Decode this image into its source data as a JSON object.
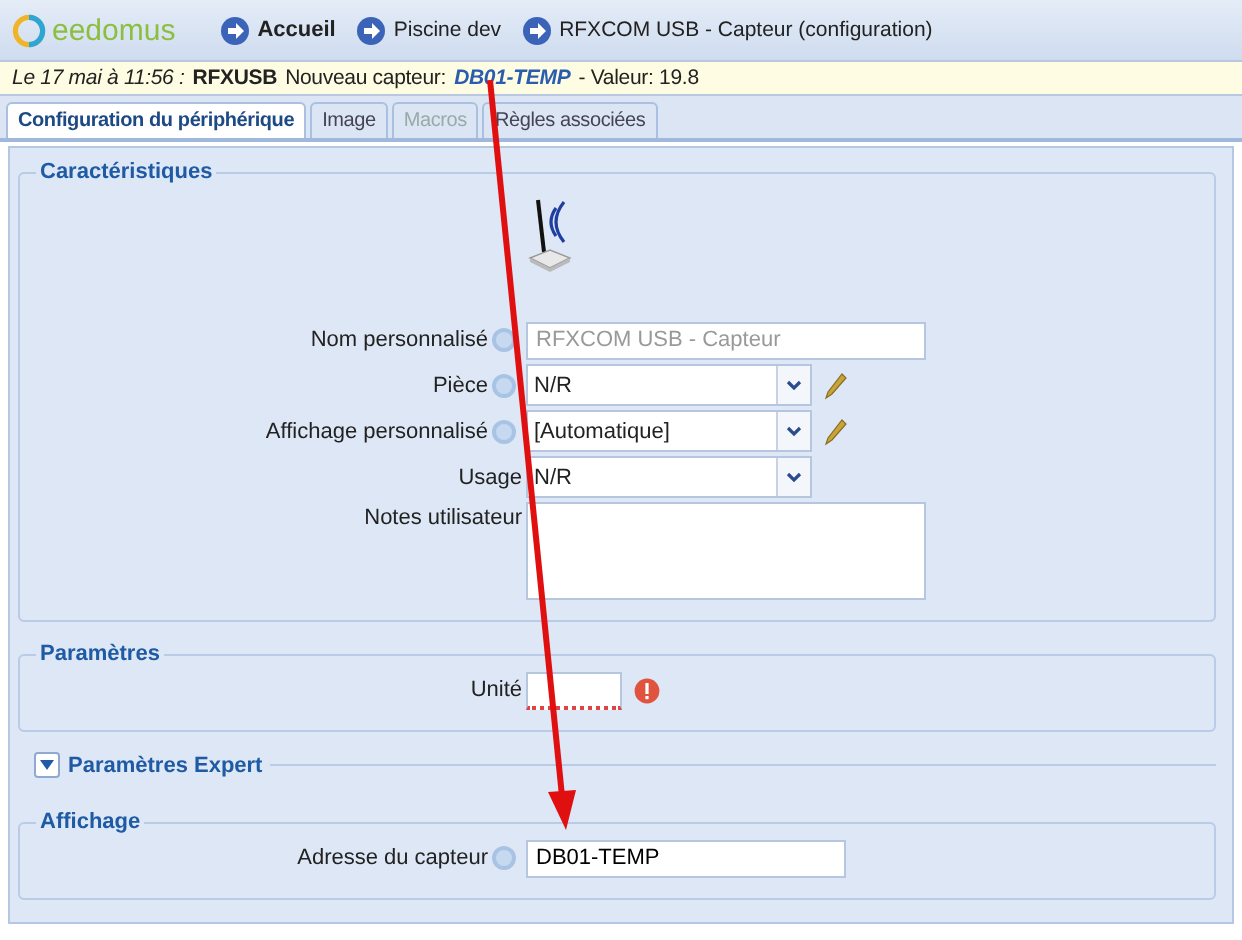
{
  "header": {
    "logo_text": "eedomus",
    "breadcrumbs": [
      {
        "label": "Accueil",
        "kind": "home"
      },
      {
        "label": "Piscine dev",
        "kind": "page"
      },
      {
        "label": "RFXCOM USB - Capteur (configuration)",
        "kind": "page"
      }
    ]
  },
  "notification": {
    "date": "Le 17 mai à 11:56 :",
    "source": "RFXUSB",
    "message": "Nouveau capteur:",
    "link": "DB01-TEMP",
    "tail": "- Valeur: 19.8"
  },
  "tabs": [
    {
      "label": "Configuration du périphérique",
      "selected": true,
      "disabled": false
    },
    {
      "label": "Image",
      "selected": false,
      "disabled": false
    },
    {
      "label": "Macros",
      "selected": false,
      "disabled": true
    },
    {
      "label": "Règles associées",
      "selected": false,
      "disabled": false
    }
  ],
  "sections": [
    {
      "kind": "fieldset",
      "title": "Caractéristiques",
      "device_icon": true,
      "fields": [
        {
          "label": "Nom personnalisé",
          "kind": "text",
          "help": true,
          "placeholder": "RFXCOM USB - Capteur",
          "edit": false,
          "error": false
        },
        {
          "label": "Pièce",
          "kind": "select",
          "help": true,
          "value": "N/R",
          "edit": true,
          "error": false
        },
        {
          "label": "Affichage personnalisé",
          "kind": "select",
          "help": true,
          "value": "[Automatique]",
          "edit": true,
          "error": false
        },
        {
          "label": "Usage",
          "kind": "select",
          "help": false,
          "value": "N/R",
          "edit": false,
          "error": false
        },
        {
          "label": "Notes utilisateur",
          "kind": "textarea",
          "help": false,
          "edit": false,
          "error": false
        }
      ]
    },
    {
      "kind": "fieldset",
      "title": "Paramètres",
      "device_icon": false,
      "fields": [
        {
          "label": "Unité",
          "kind": "short",
          "help": false,
          "edit": false,
          "error": true
        }
      ]
    },
    {
      "kind": "collapsible",
      "title": "Paramètres Expert",
      "expanded": false
    },
    {
      "kind": "fieldset",
      "title": "Affichage",
      "device_icon": false,
      "fields": [
        {
          "label": "Adresse du capteur",
          "kind": "medium",
          "help": true,
          "value": "DB01-TEMP",
          "edit": false,
          "error": false
        }
      ]
    }
  ]
}
